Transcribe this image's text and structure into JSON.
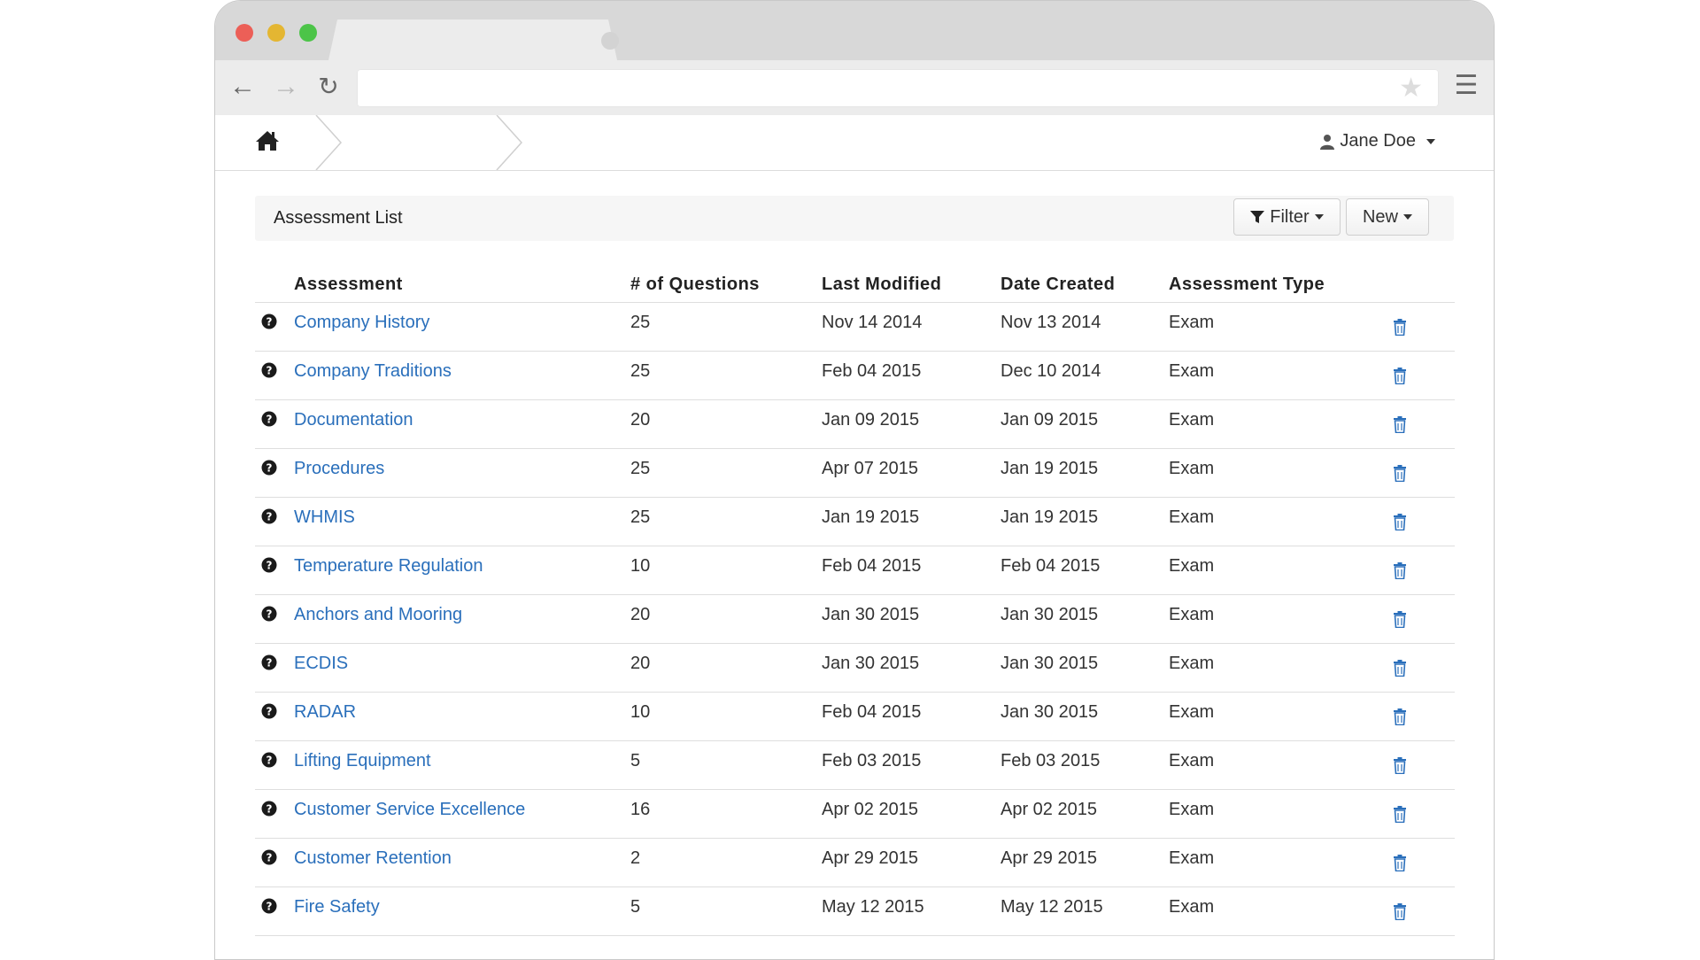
{
  "browser": {
    "tab_title": "",
    "url": ""
  },
  "appbar": {
    "user_name": "Jane Doe"
  },
  "panel": {
    "title": "Assessment List",
    "filter_label": "Filter",
    "new_label": "New"
  },
  "table": {
    "headers": {
      "assessment": "Assessment",
      "questions": "# of Questions",
      "last_modified": "Last Modified",
      "date_created": "Date Created",
      "assessment_type": "Assessment Type"
    },
    "rows": [
      {
        "name": "Company History",
        "questions": "25",
        "last_modified": "Nov 14 2014",
        "date_created": "Nov 13 2014",
        "type": "Exam"
      },
      {
        "name": "Company Traditions",
        "questions": "25",
        "last_modified": "Feb 04 2015",
        "date_created": "Dec 10 2014",
        "type": "Exam"
      },
      {
        "name": "Documentation",
        "questions": "20",
        "last_modified": "Jan 09 2015",
        "date_created": "Jan 09 2015",
        "type": "Exam"
      },
      {
        "name": "Procedures",
        "questions": "25",
        "last_modified": "Apr 07 2015",
        "date_created": "Jan 19 2015",
        "type": "Exam"
      },
      {
        "name": "WHMIS",
        "questions": "25",
        "last_modified": "Jan 19 2015",
        "date_created": "Jan 19 2015",
        "type": "Exam"
      },
      {
        "name": "Temperature Regulation",
        "questions": "10",
        "last_modified": "Feb 04 2015",
        "date_created": "Feb 04 2015",
        "type": "Exam"
      },
      {
        "name": "Anchors and Mooring",
        "questions": "20",
        "last_modified": "Jan 30 2015",
        "date_created": "Jan 30 2015",
        "type": "Exam"
      },
      {
        "name": "ECDIS",
        "questions": "20",
        "last_modified": "Jan 30 2015",
        "date_created": "Jan 30 2015",
        "type": "Exam"
      },
      {
        "name": "RADAR",
        "questions": "10",
        "last_modified": "Feb 04 2015",
        "date_created": "Jan 30 2015",
        "type": "Exam"
      },
      {
        "name": "Lifting Equipment",
        "questions": "5",
        "last_modified": "Feb 03 2015",
        "date_created": "Feb 03 2015",
        "type": "Exam"
      },
      {
        "name": "Customer Service Excellence",
        "questions": "16",
        "last_modified": "Apr 02 2015",
        "date_created": "Apr 02 2015",
        "type": "Exam"
      },
      {
        "name": "Customer Retention",
        "questions": "2",
        "last_modified": "Apr 29 2015",
        "date_created": "Apr 29 2015",
        "type": "Exam"
      },
      {
        "name": "Fire Safety",
        "questions": "5",
        "last_modified": "May 12 2015",
        "date_created": "May 12 2015",
        "type": "Exam"
      }
    ]
  },
  "icons": {
    "row_icon": "question-circle-icon",
    "delete_icon": "trash-icon",
    "home": "home-icon",
    "user": "user-icon",
    "filter": "filter-icon"
  },
  "colors": {
    "link": "#2a6fbb",
    "delete_icon": "#2a6fbb",
    "close_dot": "#ec5f57",
    "minimize_dot": "#e4b632",
    "zoom_dot": "#4cc448"
  }
}
